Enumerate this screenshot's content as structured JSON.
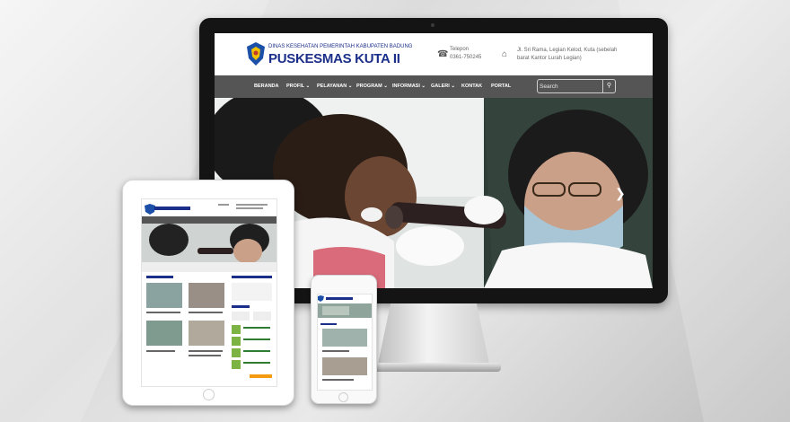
{
  "site": {
    "department": "DINAS KESEHATAN PEMERINTAH KABUPATEN BADUNG",
    "name": "PUSKESMAS KUTA II",
    "phone_label": "Telepon",
    "phone_number": "0361-750245",
    "address": "Jl. Sri Rama, Legian Kelod, Kuta (sebelah barat Kantor Lurah Legian)"
  },
  "nav": {
    "items": [
      {
        "label": "BERANDA",
        "dropdown": false
      },
      {
        "label": "PROFIL",
        "dropdown": true
      },
      {
        "label": "PELAYANAN",
        "dropdown": true
      },
      {
        "label": "PROGRAM",
        "dropdown": true
      },
      {
        "label": "INFORMASI",
        "dropdown": true
      },
      {
        "label": "GALERI",
        "dropdown": true
      },
      {
        "label": "KONTAK",
        "dropdown": false
      },
      {
        "label": "PORTAL",
        "dropdown": false
      }
    ],
    "search_placeholder": "Search"
  },
  "icons": {
    "logo": "shield-logo-icon",
    "phone": "phone-icon",
    "address": "home-icon",
    "search": "search-icon",
    "next": "chevron-right-icon"
  },
  "colors": {
    "brand": "#1b2f8a",
    "nav_bg": "#555555",
    "logo_shield": "#1b4fa8",
    "logo_accent": "#f2c200"
  }
}
